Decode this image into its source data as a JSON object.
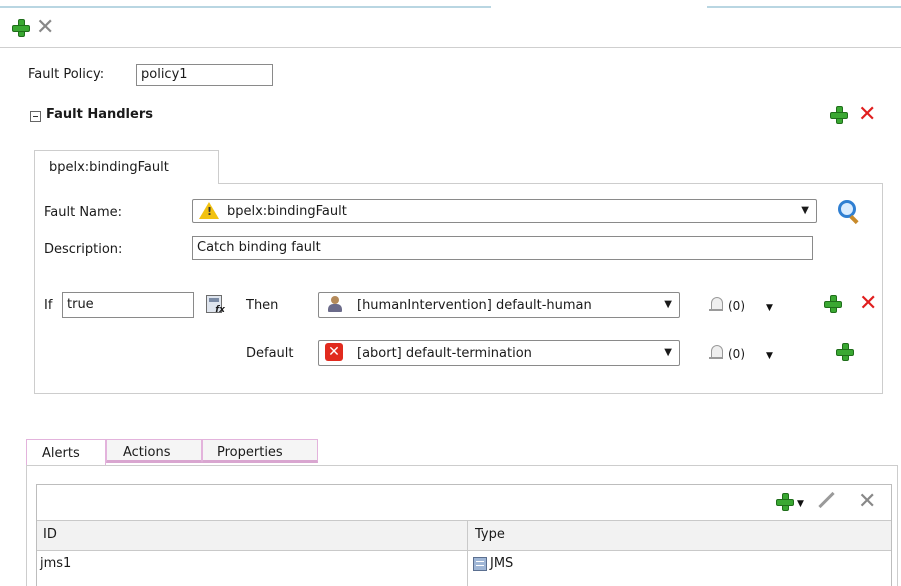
{
  "policy": {
    "label": "Fault Policy:",
    "name": "policy1"
  },
  "handlers": {
    "title": "Fault Handlers",
    "tab": "bpelx:bindingFault",
    "fault_name_label": "Fault Name:",
    "fault_name_value": "bpelx:bindingFault",
    "description_label": "Description:",
    "description_value": "Catch binding fault",
    "if_label": "If",
    "condition_value": "true",
    "then_label": "Then",
    "then_action": "[humanIntervention] default-human",
    "then_alert_count": "(0)",
    "default_label": "Default",
    "default_action": "[abort] default-termination",
    "default_alert_count": "(0)"
  },
  "bottom_tabs": [
    "Alerts",
    "Actions",
    "Properties"
  ],
  "alerts_table": {
    "columns": [
      "ID",
      "Type"
    ],
    "rows": [
      {
        "id": "jms1",
        "type": "JMS"
      }
    ]
  },
  "icons": {
    "add": "green-plus-icon",
    "remove": "red-x-icon",
    "remove_disabled": "gray-x-icon",
    "warning": "warning-icon",
    "search": "search-icon",
    "expression": "expression-builder-icon",
    "human": "human-intervention-icon",
    "abort": "abort-icon",
    "alert": "bell-icon",
    "edit": "pencil-icon",
    "jms": "jms-icon"
  },
  "colors": {
    "accent_green": "#3aa832",
    "accent_red": "#e01e1e",
    "tab_pink": "#d9a6d0"
  }
}
